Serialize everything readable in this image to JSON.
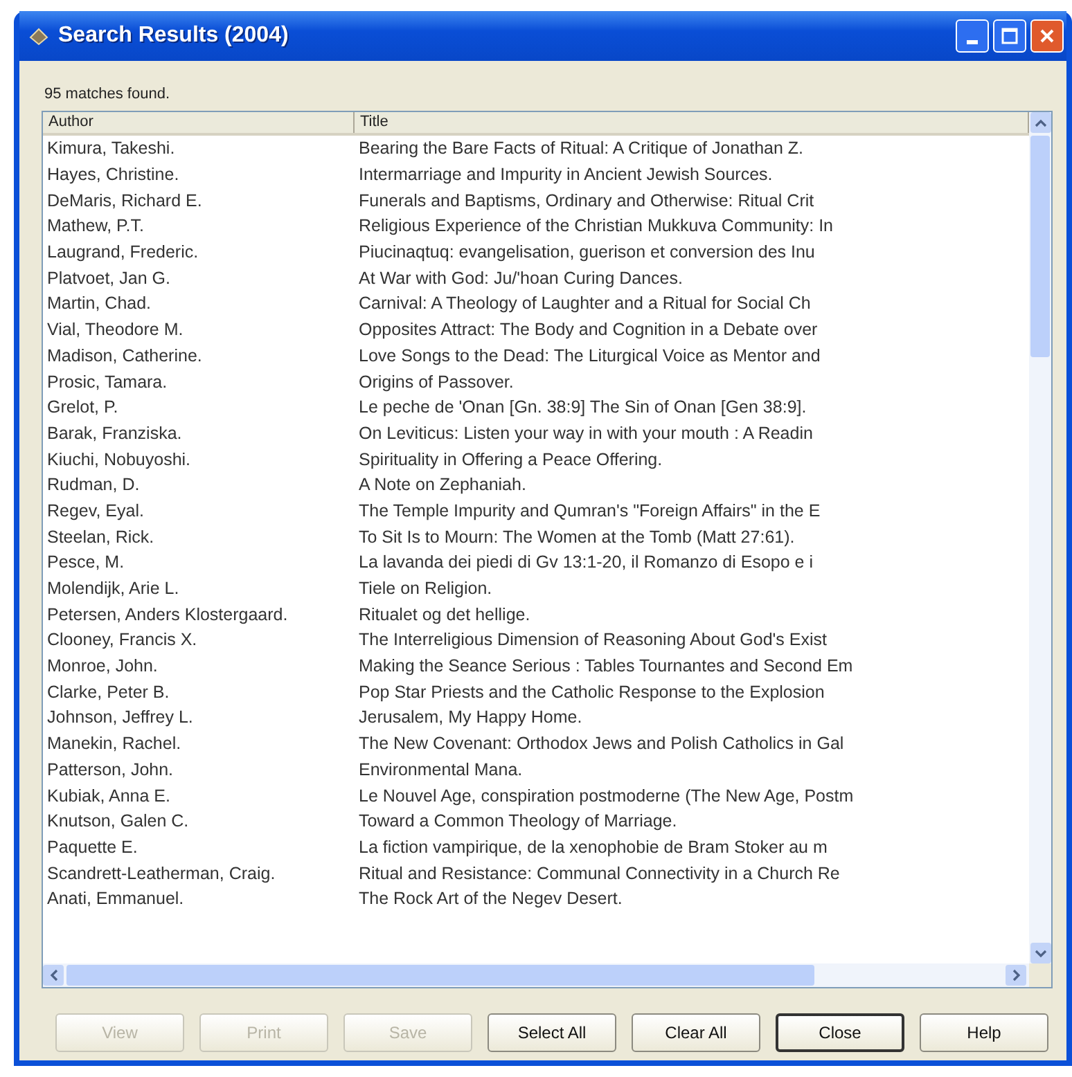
{
  "window": {
    "title": "Search Results (2004)"
  },
  "status": "95 matches found.",
  "table": {
    "columns": [
      "Author",
      "Title"
    ],
    "rows": [
      [
        "Kimura, Takeshi.",
        "Bearing the Bare Facts  of Ritual: A Critique of Jonathan Z."
      ],
      [
        "Hayes, Christine.",
        "Intermarriage and Impurity in Ancient Jewish Sources."
      ],
      [
        "DeMaris, Richard E.",
        "Funerals and Baptisms, Ordinary and Otherwise: Ritual Crit"
      ],
      [
        "Mathew, P.T.",
        "Religious Experience of the Christian Mukkuva Community: In"
      ],
      [
        "Laugrand, Frederic.",
        "Piucinaqtuq: evangelisation, guerison et conversion des Inu"
      ],
      [
        "Platvoet, Jan G.",
        "At War with God: Ju/'hoan Curing Dances."
      ],
      [
        "Martin, Chad.",
        "Carnival: A Theology of Laughter and a Ritual for Social Ch"
      ],
      [
        "Vial, Theodore M.",
        "Opposites Attract: The Body and Cognition in a Debate over"
      ],
      [
        "Madison, Catherine.",
        "Love Songs to the Dead: The Liturgical Voice as Mentor and"
      ],
      [
        "Prosic, Tamara.",
        "Origins of Passover."
      ],
      [
        "Grelot, P.",
        "Le peche de 'Onan [Gn. 38:9] The Sin of Onan [Gen 38:9]."
      ],
      [
        "Barak, Franziska.",
        "On Leviticus: Listen your way in with your mouth : A Readin"
      ],
      [
        "Kiuchi, Nobuyoshi.",
        "Spirituality in Offering a Peace Offering."
      ],
      [
        "Rudman, D.",
        "A Note on Zephaniah."
      ],
      [
        "Regev, Eyal.",
        "The Temple Impurity and Qumran's \"Foreign Affairs\" in the E"
      ],
      [
        "Steelan, Rick.",
        "To Sit Is to Mourn: The Women at the Tomb (Matt 27:61)."
      ],
      [
        "Pesce, M.",
        "La lavanda dei piedi di Gv 13:1-20, il Romanzo di Esopo e i"
      ],
      [
        "Molendijk, Arie L.",
        "Tiele on Religion."
      ],
      [
        "Petersen, Anders Klostergaard.",
        "Ritualet og det hellige."
      ],
      [
        "Clooney, Francis X.",
        "The Interreligious Dimension of Reasoning About God's Exist"
      ],
      [
        "Monroe, John.",
        "Making the Seance Serious : Tables Tournantes and Second Em"
      ],
      [
        "Clarke, Peter B.",
        "Pop Star Priests and the Catholic Response to the Explosion"
      ],
      [
        "Johnson, Jeffrey L.",
        "Jerusalem, My Happy Home."
      ],
      [
        "Manekin, Rachel.",
        "The New Covenant: Orthodox Jews and Polish Catholics in Gal"
      ],
      [
        "Patterson, John.",
        "Environmental Mana."
      ],
      [
        "Kubiak, Anna E.",
        "Le Nouvel Age, conspiration postmoderne (The New Age, Postm"
      ],
      [
        "Knutson, Galen C.",
        "Toward a Common Theology of Marriage."
      ],
      [
        "Paquette E.",
        "La fiction vampirique, de la xenophobie de Bram Stoker au m"
      ],
      [
        "Scandrett-Leatherman, Craig.",
        "Ritual and Resistance: Communal Connectivity in a Church Re"
      ],
      [
        "Anati, Emmanuel.",
        "The Rock Art of the Negev Desert."
      ]
    ]
  },
  "buttons": [
    {
      "label": "View",
      "disabled": true,
      "default": false
    },
    {
      "label": "Print",
      "disabled": true,
      "default": false
    },
    {
      "label": "Save",
      "disabled": true,
      "default": false
    },
    {
      "label": "Select All",
      "disabled": false,
      "default": false
    },
    {
      "label": "Clear All",
      "disabled": false,
      "default": false
    },
    {
      "label": "Close",
      "disabled": false,
      "default": true
    },
    {
      "label": "Help",
      "disabled": false,
      "default": false
    }
  ]
}
